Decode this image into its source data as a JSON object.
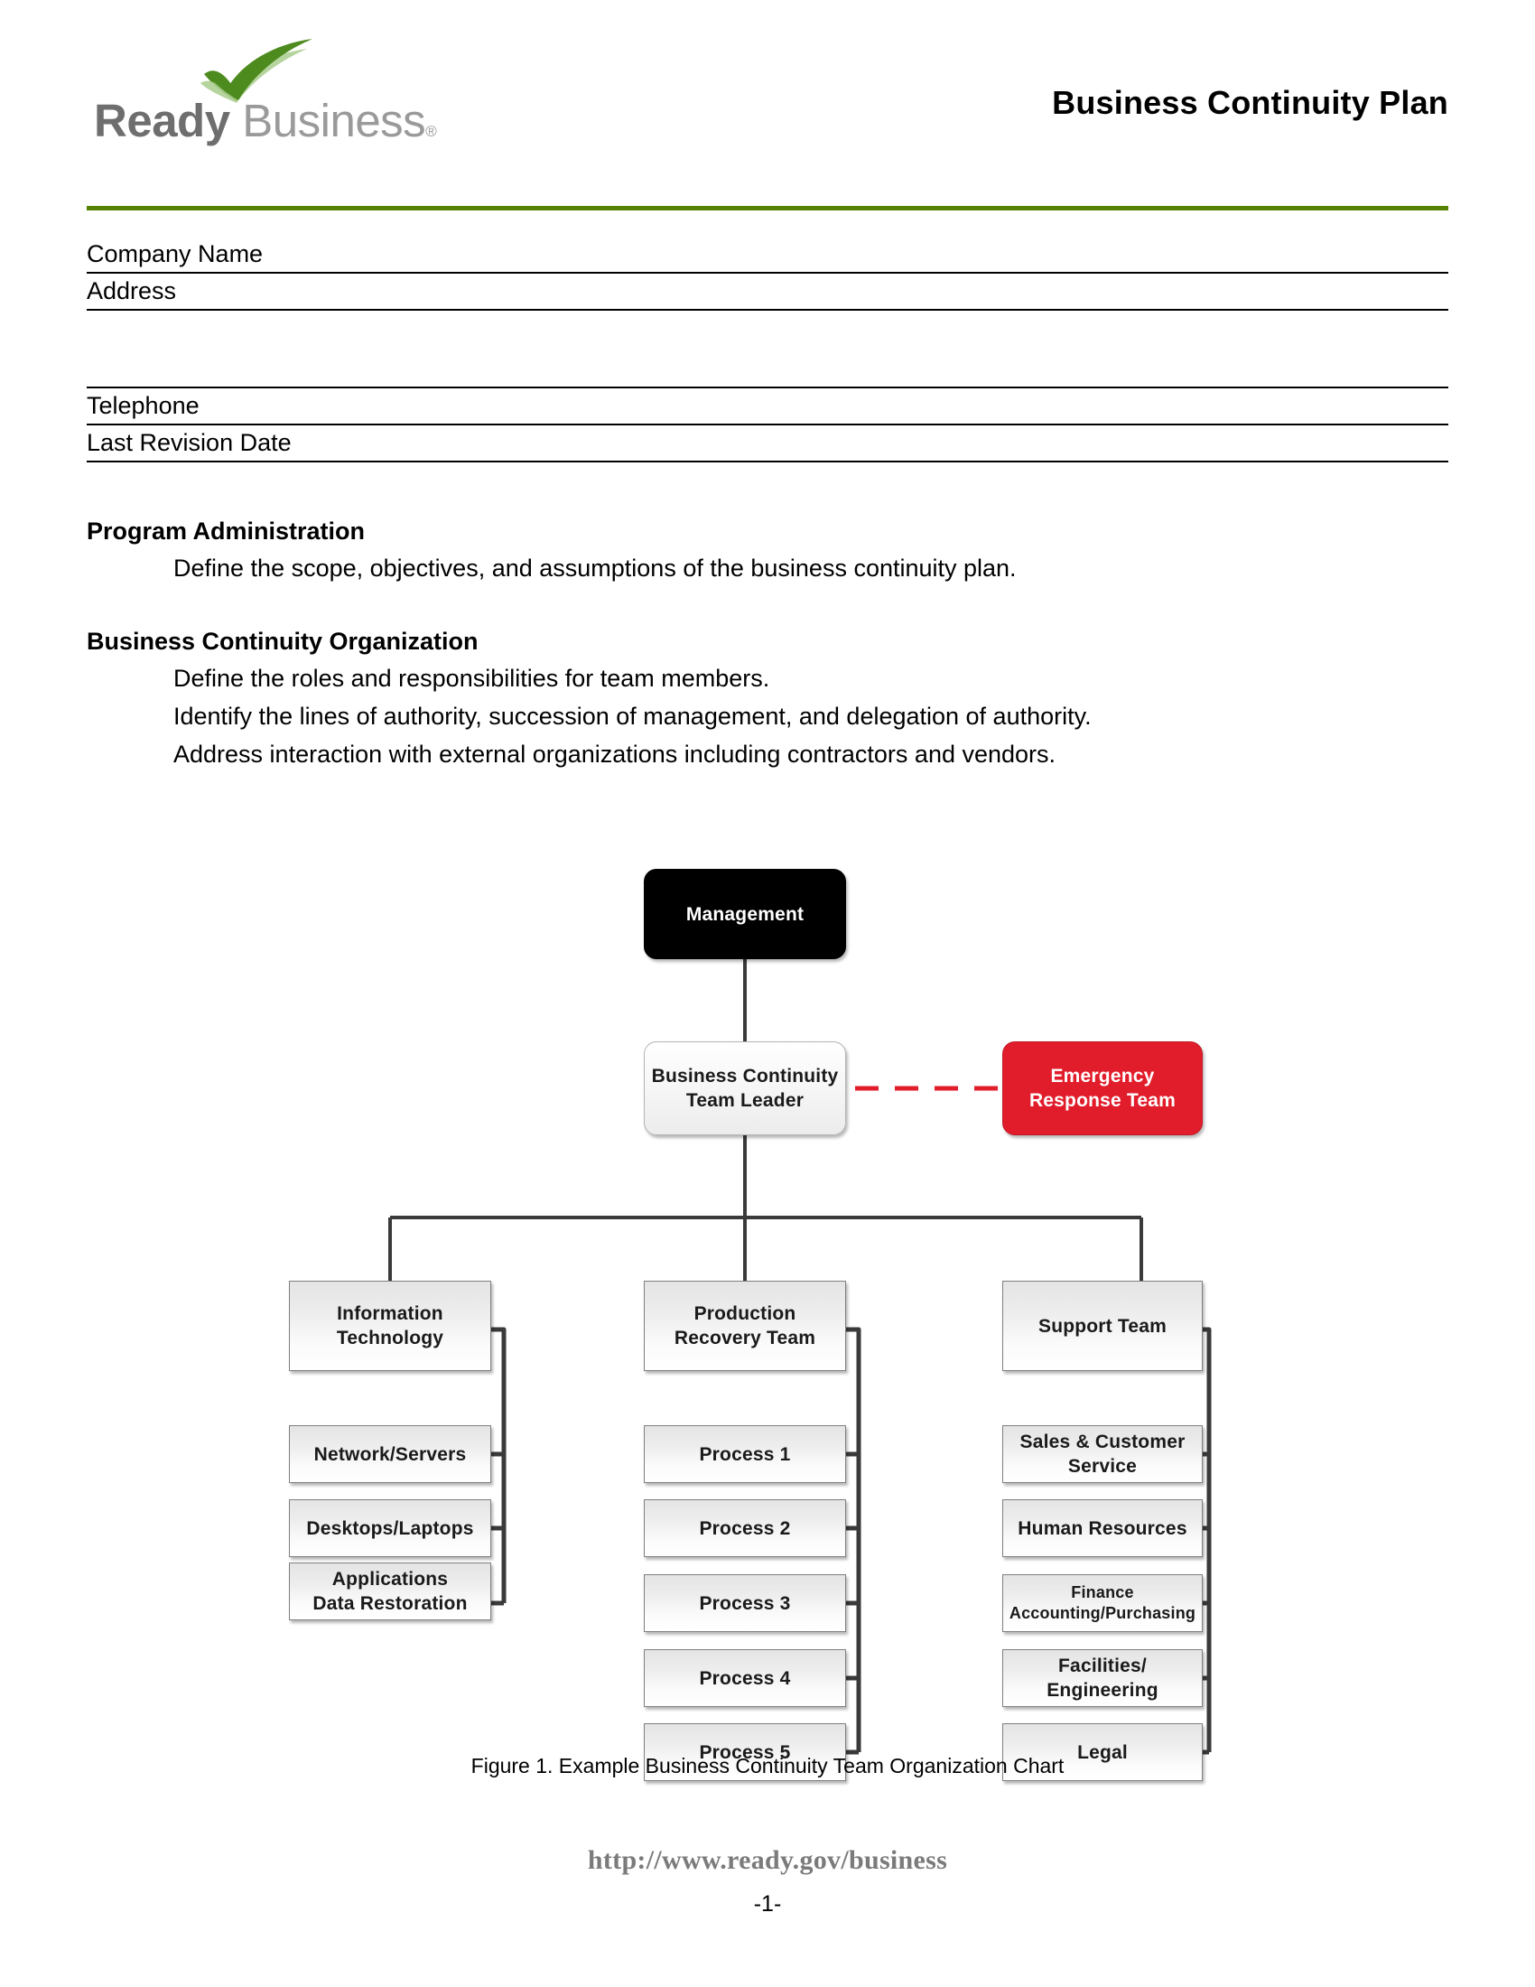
{
  "header": {
    "logo": {
      "brand_primary": "Ready",
      "brand_secondary": " Business",
      "registered_mark": "®",
      "check_color_dark": "#4d8b1f",
      "check_color_light": "#a9cd8d",
      "text_color_primary": "#6e6e6e",
      "text_color_secondary": "#9a9a9a"
    },
    "document_title": "Business Continuity Plan",
    "rule_color": "#568203"
  },
  "form_fields": [
    {
      "label": "Company Name",
      "value": ""
    },
    {
      "label": "Address",
      "value": ""
    },
    {
      "label": "Telephone",
      "value": ""
    },
    {
      "label": "Last Revision Date",
      "value": ""
    }
  ],
  "sections": [
    {
      "heading": "Program Administration",
      "lines": [
        "Define the scope, objectives, and assumptions of the business continuity plan."
      ]
    },
    {
      "heading": "Business Continuity Organization",
      "lines": [
        "Define the roles and responsibilities for team members.",
        "Identify the lines of authority, succession of management, and delegation of authority.",
        "Address interaction with external organizations including contractors and vendors."
      ]
    }
  ],
  "chart_data": {
    "type": "diagram",
    "title": "Example Business Continuity Team Organization Chart",
    "caption": "Figure 1. Example Business Continuity Team Organization Chart",
    "colors": {
      "management_fill": "#000000",
      "management_text": "#ffffff",
      "emergency_fill": "#e21d2b",
      "emergency_text": "#ffffff",
      "node_fill": "#eeeeee",
      "node_text": "#1a1a1a",
      "connector": "#3a3a3a",
      "dashed_connector": "#e21d2b"
    },
    "nodes": {
      "root": "Management",
      "leader": "Business Continuity\nTeam Leader",
      "leader_line1": "Business Continuity",
      "leader_line2": "Team Leader",
      "emergency_line1": "Emergency",
      "emergency_line2": "Response Team"
    },
    "columns": [
      {
        "head_line1": "Information",
        "head_line2": "Technology",
        "children": [
          {
            "line1": "Network/Servers",
            "line2": ""
          },
          {
            "line1": "Desktops/Laptops",
            "line2": ""
          },
          {
            "line1": "Applications",
            "line2": "Data Restoration"
          }
        ]
      },
      {
        "head_line1": "Production",
        "head_line2": "Recovery Team",
        "children": [
          {
            "line1": "Process 1",
            "line2": ""
          },
          {
            "line1": "Process 2",
            "line2": ""
          },
          {
            "line1": "Process 3",
            "line2": ""
          },
          {
            "line1": "Process 4",
            "line2": ""
          },
          {
            "line1": "Process 5",
            "line2": ""
          }
        ]
      },
      {
        "head_line1": "Support Team",
        "head_line2": "",
        "children": [
          {
            "line1": "Sales & Customer",
            "line2": "Service"
          },
          {
            "line1": "Human Resources",
            "line2": ""
          },
          {
            "line1": "Finance",
            "line2": "Accounting/Purchasing"
          },
          {
            "line1": "Facilities/",
            "line2": "Engineering"
          },
          {
            "line1": "Legal",
            "line2": ""
          }
        ]
      }
    ]
  },
  "footer": {
    "url": "http://www.ready.gov/business",
    "page_number": "-1-"
  }
}
